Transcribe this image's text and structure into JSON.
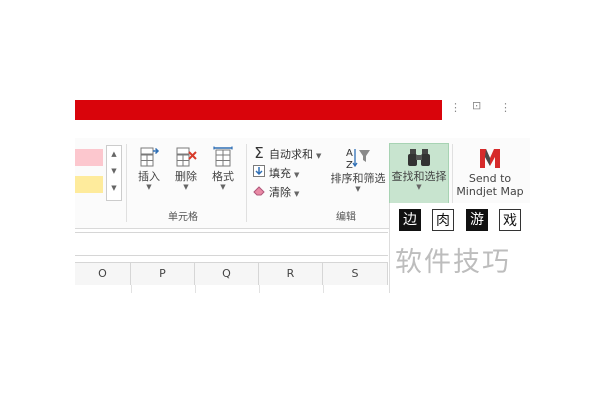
{
  "ribbon": {
    "cells_group": {
      "label": "单元格",
      "insert": {
        "label": "插入",
        "icon": "insert-cells-icon"
      },
      "delete": {
        "label": "删除",
        "icon": "delete-cells-icon"
      },
      "format": {
        "label": "格式",
        "icon": "format-cells-icon"
      }
    },
    "editing_group": {
      "label": "编辑",
      "autosum": {
        "label": "自动求和",
        "icon": "sigma-icon"
      },
      "fill": {
        "label": "填充",
        "icon": "fill-down-icon"
      },
      "clear": {
        "label": "清除",
        "icon": "eraser-icon"
      },
      "sort_filter": {
        "label": "排序和筛选",
        "icon": "sort-filter-icon"
      },
      "find_select": {
        "label": "查找和选择",
        "icon": "binoculars-icon"
      }
    },
    "addin": {
      "label_line1": "Send to",
      "label_line2": "Mindjet Map",
      "icon": "mindjet-icon"
    }
  },
  "styles": {
    "swatches": [
      "#fcc7ce",
      "#feeb9c"
    ]
  },
  "sheet": {
    "columns": [
      "O",
      "P",
      "Q",
      "R",
      "S"
    ]
  },
  "watermark": {
    "boxes": [
      "边",
      "肉",
      "游",
      "戏"
    ],
    "text": "软件技巧"
  },
  "colors": {
    "title_bar": "#d9040b",
    "find_select_highlight": "#c8e4cf",
    "mindjet_red": "#d62b2b"
  }
}
